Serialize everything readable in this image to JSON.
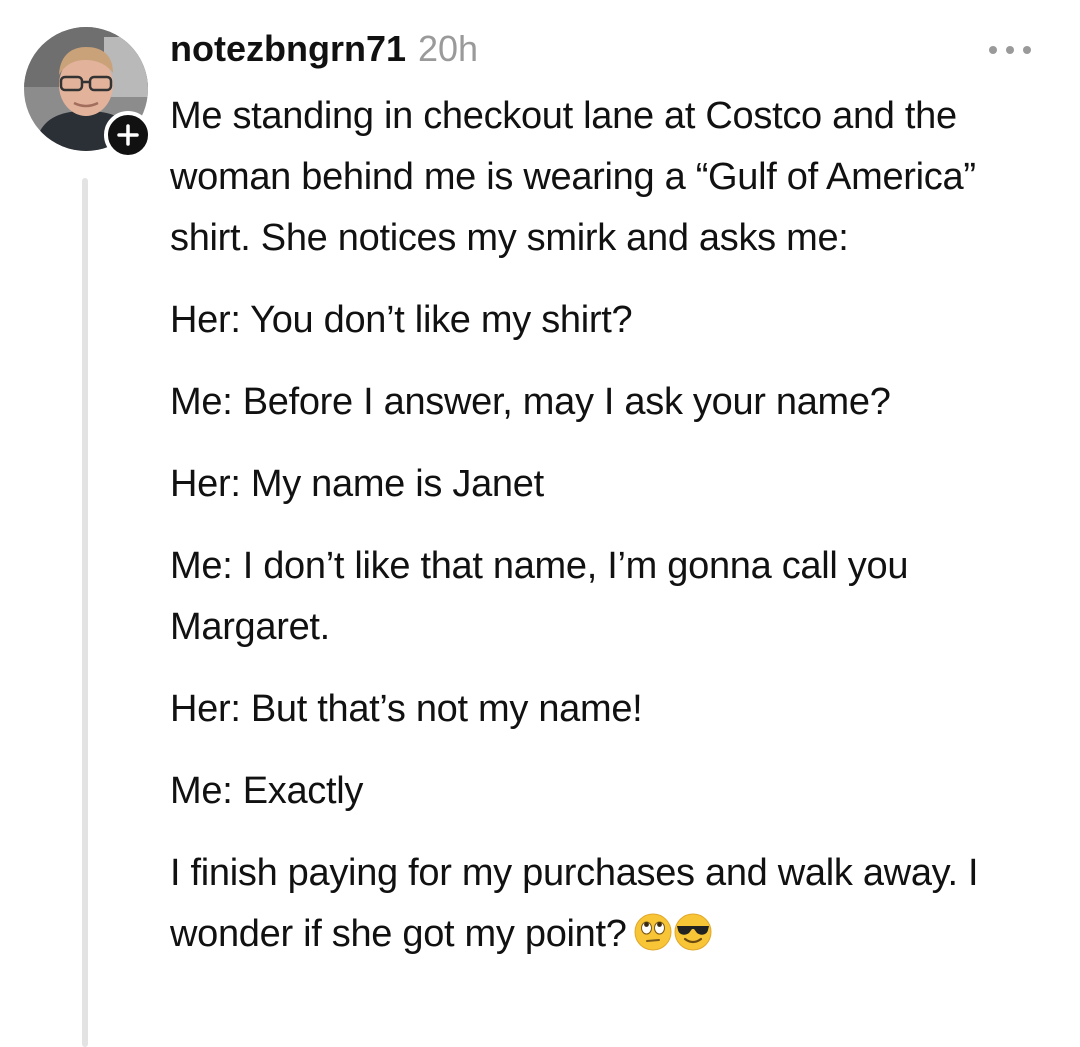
{
  "post": {
    "username": "notezbngrn71",
    "timestamp": "20h",
    "paragraphs": [
      "Me standing in checkout lane at Costco and the woman behind me is wearing a “Gulf of America” shirt. She notices my smirk and asks me:",
      "Her: You don’t like my shirt?",
      "Me: Before I answer, may I ask your name?",
      "Her: My name is Janet",
      "Me: I don’t like that name, I’m gonna call you Margaret.",
      "Her: But that’s not my name!",
      "Me: Exactly",
      "I finish paying for my purchases and walk away. I wonder if she got my point?"
    ],
    "emojis": [
      "face-with-rolling-eyes-emoji",
      "smiling-face-with-sunglasses-emoji"
    ]
  },
  "icons": {
    "avatar": "avatar-photo",
    "follow": "plus-icon",
    "more": "more-options-icon"
  },
  "colors": {
    "text": "#111111",
    "muted": "#9a9a9a",
    "thread_line": "#e3e3e3",
    "badge": "#111111"
  }
}
